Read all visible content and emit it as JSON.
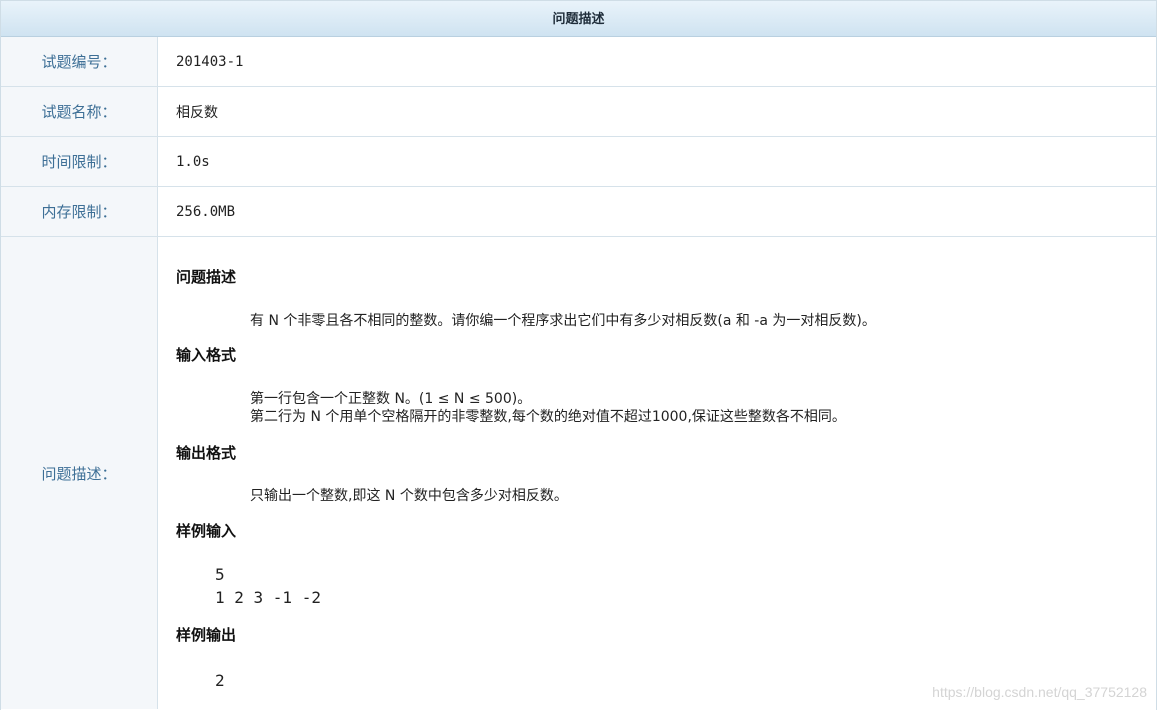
{
  "header": {
    "title": "问题描述"
  },
  "fields": {
    "id": {
      "label": "试题编号：",
      "value": "201403-1"
    },
    "name": {
      "label": "试题名称：",
      "value": "相反数"
    },
    "time": {
      "label": "时间限制：",
      "value": "1.0s"
    },
    "memory": {
      "label": "内存限制：",
      "value": "256.0MB"
    }
  },
  "description": {
    "label": "问题描述：",
    "problem_title": "问题描述",
    "problem_text": "有 N 个非零且各不相同的整数。请你编一个程序求出它们中有多少对相反数(a 和 -a 为一对相反数)。",
    "input_title": "输入格式",
    "input_line1": "第一行包含一个正整数 N。(1 ≤ N ≤ 500)。",
    "input_line2": "第二行为 N 个用单个空格隔开的非零整数,每个数的绝对值不超过1000,保证这些整数各不相同。",
    "output_title": "输出格式",
    "output_text": "只输出一个整数,即这 N 个数中包含多少对相反数。",
    "sample_input_title": "样例输入",
    "sample_input_line1": "5",
    "sample_input_line2": "1 2 3 -1 -2",
    "sample_output_title": "样例输出",
    "sample_output_line1": "2"
  },
  "watermark": "https://blog.csdn.net/qq_37752128"
}
